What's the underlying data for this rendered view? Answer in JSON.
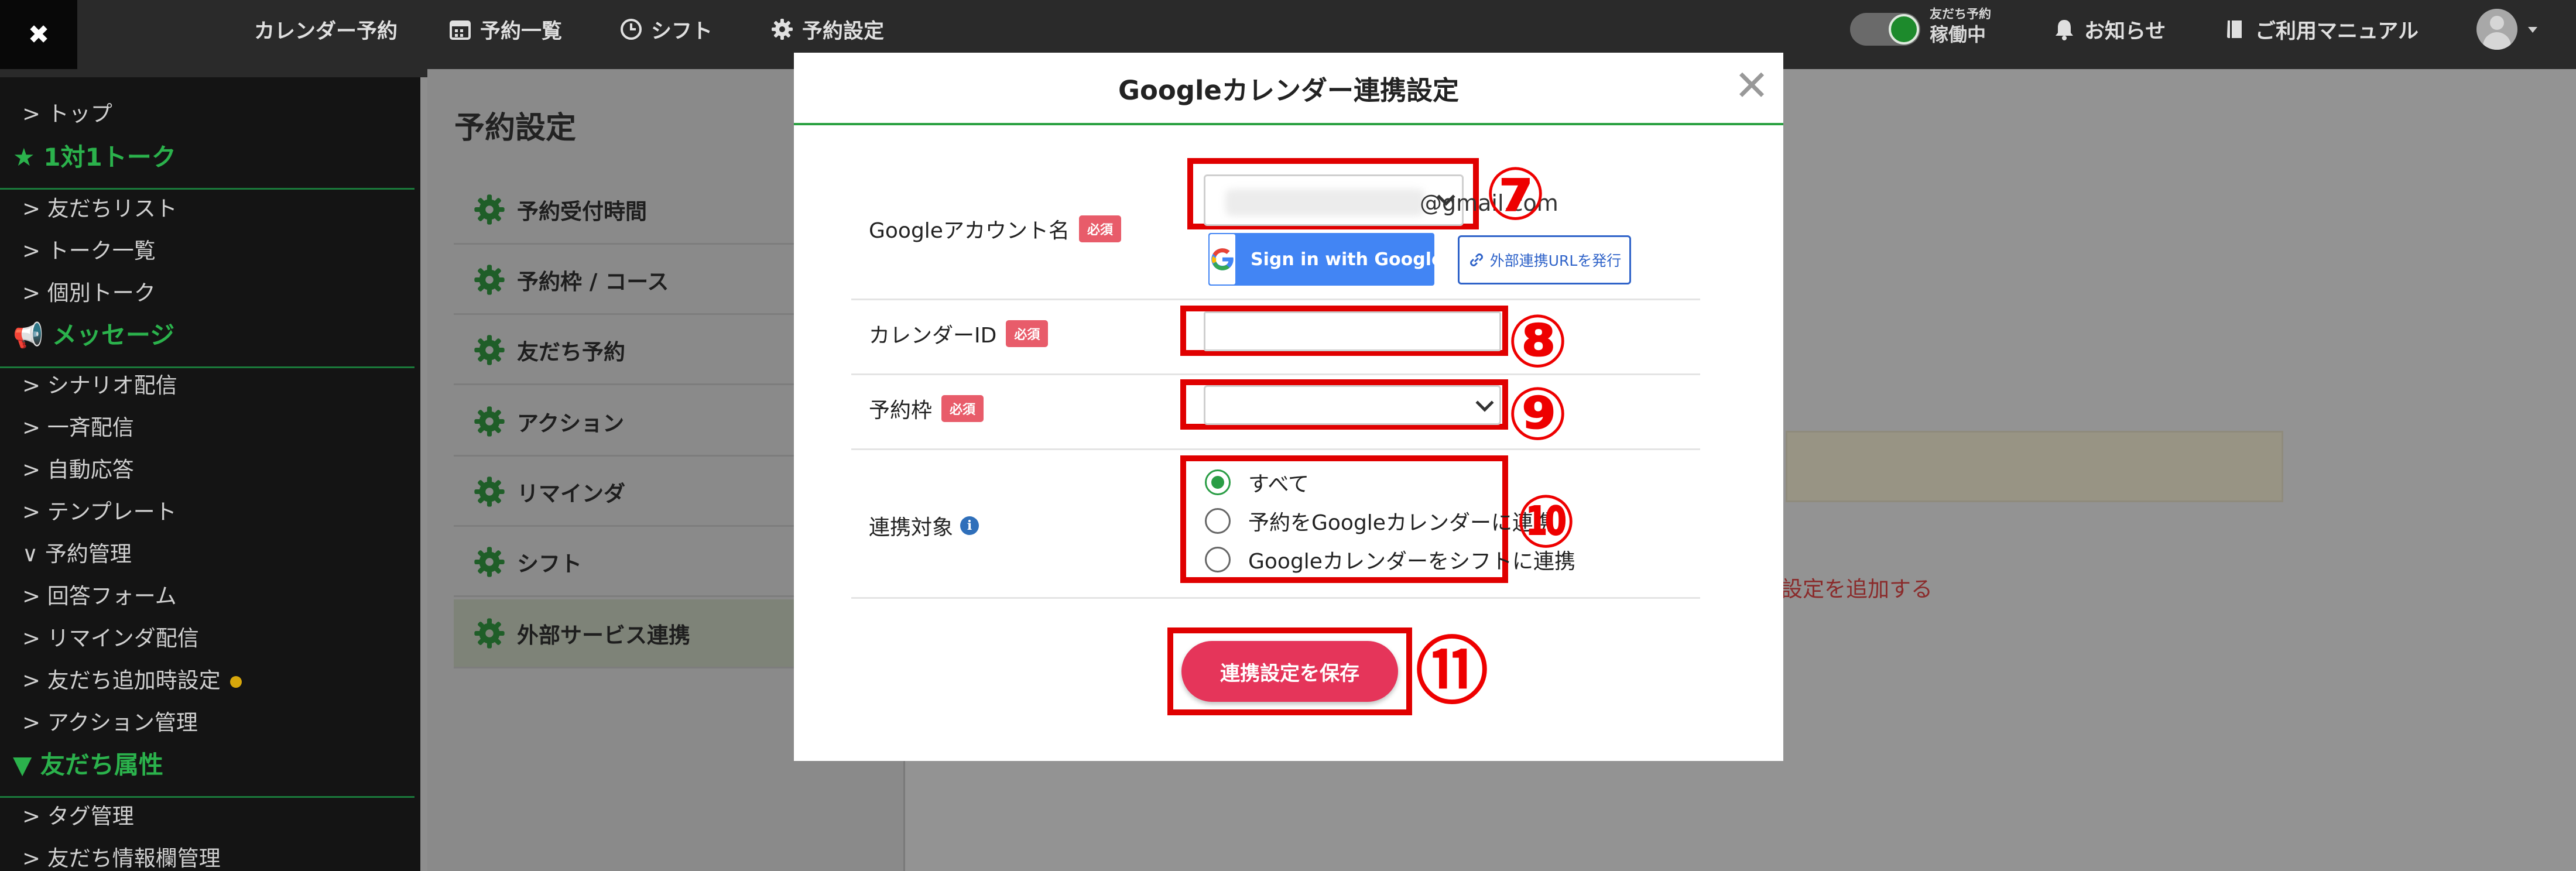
{
  "topbar": {
    "logo_glyph": "✖",
    "nav": [
      {
        "label": "カレンダー予約",
        "icon": "none"
      },
      {
        "label": "予約一覧",
        "icon": "calendar-icon"
      },
      {
        "label": "シフト",
        "icon": "clock-icon"
      },
      {
        "label": "予約設定",
        "icon": "gear-icon"
      }
    ],
    "friend_status_small": "友だち予約",
    "friend_status_big": "稼働中",
    "notifications": "お知らせ",
    "manual": "ご利用マニュアル"
  },
  "sidebar": {
    "items": [
      {
        "kind": "link",
        "label": "> トップ"
      },
      {
        "kind": "head",
        "label": "★ 1対1トーク"
      },
      {
        "kind": "link",
        "label": "> 友だちリスト"
      },
      {
        "kind": "link",
        "label": "> トーク一覧"
      },
      {
        "kind": "link",
        "label": "> 個別トーク"
      },
      {
        "kind": "head",
        "label": "📢 メッセージ"
      },
      {
        "kind": "link",
        "label": "> シナリオ配信"
      },
      {
        "kind": "link",
        "label": "> 一斉配信"
      },
      {
        "kind": "link",
        "label": "> 自動応答"
      },
      {
        "kind": "link",
        "label": "> テンプレート"
      },
      {
        "kind": "link",
        "label": "∨ 予約管理"
      },
      {
        "kind": "link",
        "label": "> 回答フォーム"
      },
      {
        "kind": "link",
        "label": "> リマインダ配信"
      },
      {
        "kind": "link",
        "label": "> 友だち追加時設定"
      },
      {
        "kind": "link",
        "label": "> アクション管理"
      },
      {
        "kind": "head",
        "label": "▼ 友だち属性"
      },
      {
        "kind": "link",
        "label": "> タグ管理"
      },
      {
        "kind": "link",
        "label": "> 友だち情報欄管理"
      }
    ]
  },
  "page": {
    "title": "予約設定",
    "menu": [
      "予約受付時間",
      "予約枠 / コース",
      "友だち予約",
      "アクション",
      "リマインダ",
      "シフト",
      "外部サービス連携"
    ],
    "active_index": 6,
    "bg_link": "設定を追加する"
  },
  "modal": {
    "title": "Googleカレンダー連携設定",
    "close_glyph": "✕",
    "required_badge": "必須",
    "account_label": "Googleアカウント名",
    "account_value": "@gmail.com",
    "google_button": "Sign in with Google",
    "url_button": "外部連携URLを発行",
    "calendar_label": "カレンダーID",
    "calendar_value": "",
    "slot_label": "予約枠",
    "slot_value": "",
    "target_label": "連携対象",
    "target_options": [
      "すべて",
      "予約をGoogleカレンダーに連携",
      "Googleカレンダーをシフトに連携"
    ],
    "target_selected": 0,
    "save_button": "連携設定を保存"
  },
  "annotations": [
    "⑦",
    "⑧",
    "⑨",
    "⑩",
    "⑪"
  ],
  "colors": {
    "accent_green": "#2aa141",
    "save_red": "#e5355a",
    "annotation_red": "#ee0000",
    "google_blue": "#4285f4"
  }
}
